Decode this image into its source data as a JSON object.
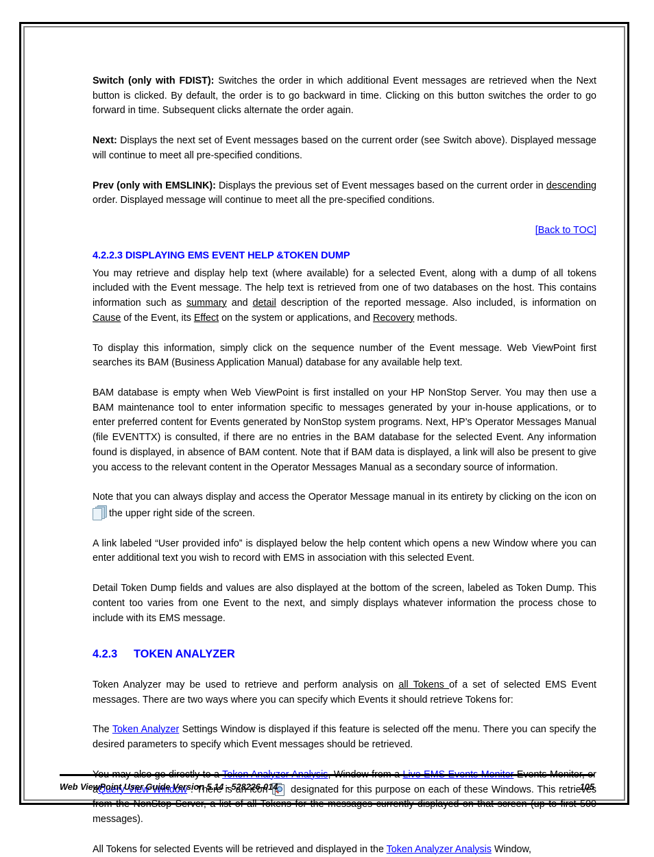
{
  "page": {
    "border_color": "#000000",
    "inner_rule_color": "#808080",
    "link_color": "#0000ff",
    "heading_color": "#0000ff"
  },
  "body": {
    "p_switch_lead": "Switch (only with FDIST):",
    "p_switch_rest": " Switches the order in which additional Event messages are retrieved when the Next button is clicked.  By default, the order is to go backward in time. Clicking on this button switches the order to go forward in time.  Subsequent clicks alternate the order again.",
    "p_next_lead": "Next:",
    "p_next_rest": " Displays the next set of Event messages based on the current order (see Switch above).  Displayed message will continue to meet all pre-specified conditions.",
    "p_prev_lead": "Prev (only with EMSLINK):",
    "p_prev_mid": " Displays the previous set of Event messages based on the current order in ",
    "p_prev_underline": "descending",
    "p_prev_end": " order. Displayed message will continue to meet all the pre-specified conditions.",
    "back_to_toc": "[Back to TOC]",
    "heading_4223": "4.2.2.3 DISPLAYING EMS EVENT HELP &TOKEN DUMP",
    "p_help_a": "You may retrieve and display help text (where available) for a selected Event, along with a dump of all tokens included with the Event message.  The help text is retrieved from one of two databases on the host.  This contains information such as ",
    "p_help_u1": "summary",
    "p_help_b": " and ",
    "p_help_u2": "detail",
    "p_help_c": " description of the reported message.  Also included, is information on ",
    "p_help_u3": "Cause",
    "p_help_d": " of the Event, its ",
    "p_help_u4": "Effect",
    "p_help_e": " on the system or applications, and ",
    "p_help_u5": "Recovery",
    "p_help_f": " methods.",
    "p_display": "To display this information, simply click on the sequence number of the Event message.  Web ViewPoint first searches its BAM (Business Application Manual) database for any available help text.",
    "p_bam": "BAM database is empty when Web ViewPoint is first installed on your HP NonStop Server.  You may then use a BAM maintenance tool to enter information specific to messages generated by your in-house applications, or to enter preferred content for Events generated by NonStop system programs.  Next, HP’s Operator Messages Manual (file EVENTTX) is consulted, if there are no entries in the BAM database for the selected Event.  Any information found is displayed, in absence of BAM content.  Note that if BAM data is displayed, a link will also be present to give you access to the relevant content in the Operator Messages Manual as a secondary source of information.",
    "p_note_a": "Note that you can always display and access the Operator Message manual in its entirety by clicking on the icon on ",
    "p_note_b": " the upper right side of the screen.",
    "p_userinfo": "A link labeled “User provided info” is displayed below the help content which opens a new Window where you can enter additional text you wish to record with EMS in association with this selected Event.",
    "p_tokendump": "Detail Token Dump fields and values are also displayed at the bottom of the screen, labeled as Token Dump.  This content too varies from one Event to the next, and simply displays whatever information the process chose to include with its EMS message.",
    "heading_423_num": "4.2.3",
    "heading_423_text": "TOKEN ANALYZER",
    "p_ta_a": "Token Analyzer may be used to retrieve and perform analysis on ",
    "p_ta_u": "all Tokens ",
    "p_ta_b": "of a set of selected EMS Event messages.   There are two ways where you can specify which Events it should retrieve Tokens for:",
    "p_settings_a": "The ",
    "p_settings_link": "Token Analyzer",
    "p_settings_b": " Settings Window is displayed if this feature is selected off the menu.  There you can specify the desired parameters to specify which Event messages should be retrieved.",
    "p_direct_a": "You may also go directly to a ",
    "p_direct_link1": "Token Analyzer Analysis",
    "p_direct_b": ", Window from a ",
    "p_direct_link2": "Live EMS Events Monitor",
    "p_direct_c": " Events Monitor, or a",
    "p_direct_link3": "Query View Window",
    "p_direct_d": " .  There is an icon ",
    "p_direct_e": " designated for this purpose on each of these Windows.  This retrieves from the NonStop Server, a list of all Tokens for the messages currently displayed on that screen (up to first 500 messages).",
    "p_all_a": "All Tokens for selected Events will be retrieved and displayed in the ",
    "p_all_link": "Token Analyzer Analysis",
    "p_all_b": " Window,"
  },
  "footer": {
    "left": "Web ViewPoint User Guide Version 5.14 - 528226-014",
    "page_number": "105"
  },
  "icons": {
    "docs_stack": "documents-stack-icon",
    "docs_search": "documents-search-icon"
  }
}
